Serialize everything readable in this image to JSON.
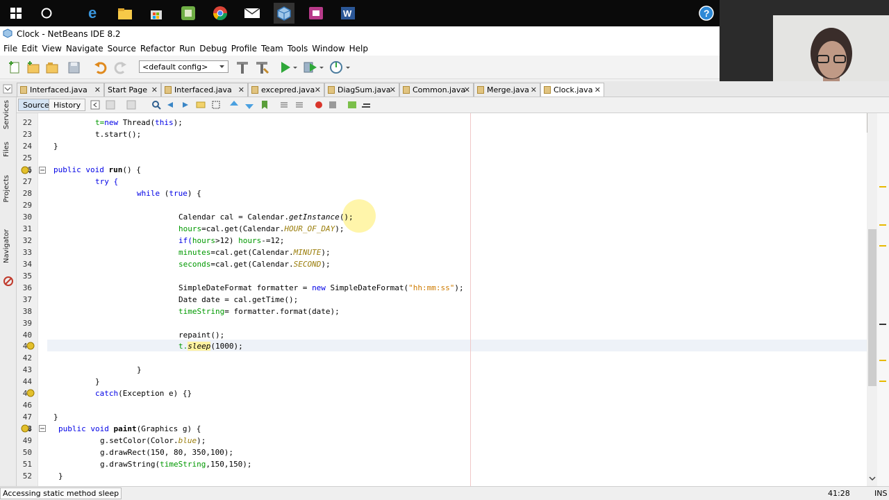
{
  "window": {
    "title": "Clock - NetBeans IDE 8.2"
  },
  "menu": [
    "File",
    "Edit",
    "View",
    "Navigate",
    "Source",
    "Refactor",
    "Run",
    "Debug",
    "Profile",
    "Team",
    "Tools",
    "Window",
    "Help"
  ],
  "toolbar": {
    "config_value": "<default config>"
  },
  "tabs": [
    {
      "label": "Interfaced.java"
    },
    {
      "label": "Start Page"
    },
    {
      "label": "Interfaced.java"
    },
    {
      "label": "excepred.java"
    },
    {
      "label": "DiagSum.java"
    },
    {
      "label": "Common.java"
    },
    {
      "label": "Merge.java"
    },
    {
      "label": "Clock.java",
      "active": true
    }
  ],
  "editor_toolbar": {
    "source_label": "Source",
    "history_label": "History"
  },
  "left_dock": [
    "Services",
    "Files",
    "Projects",
    "Navigator"
  ],
  "lines": [
    "22",
    "23",
    "24",
    "25",
    "26",
    "27",
    "28",
    "29",
    "30",
    "31",
    "32",
    "33",
    "34",
    "35",
    "36",
    "37",
    "38",
    "39",
    "40",
    "41",
    "42",
    "43",
    "44",
    "45",
    "46",
    "47",
    "48",
    "49",
    "50",
    "51",
    "52"
  ],
  "code": {
    "l22a": "t=",
    "l22b": "new",
    "l22c": " Thread(",
    "l22d": "this",
    "l22e": ");",
    "l23": "t.start();",
    "l24": "}",
    "l26a": "public void",
    "l26b": " run",
    "l26c": "() {",
    "l27": "try {",
    "l28a": "while",
    "l28b": " (",
    "l28c": "true",
    "l28d": ") {",
    "l30a": "Calendar cal = Calendar.",
    "l30b": "getInstance",
    "l30c": "();",
    "l31a": "hours",
    "l31b": "=cal.get(Calendar.",
    "l31c": "HOUR_OF_DAY",
    "l31d": ");",
    "l32a": "if(",
    "l32b": "hours",
    "l32c": ">12) ",
    "l32d": "hours",
    "l32e": "-=12;",
    "l33a": "minutes",
    "l33b": "=cal.get(Calendar.",
    "l33c": "MINUTE",
    "l33d": ");",
    "l34a": "seconds",
    "l34b": "=cal.get(Calendar.",
    "l34c": "SECOND",
    "l34d": ");",
    "l36a": "SimpleDateFormat formatter = ",
    "l36b": "new",
    "l36c": " SimpleDateFormat(",
    "l36d": "\"hh:mm:ss\"",
    "l36e": ");",
    "l37": "Date date = cal.getTime();",
    "l38a": "timeString",
    "l38b": "= formatter.format(date);",
    "l40": "repaint();",
    "l41a": "t.",
    "l41b": "sleep",
    "l41c": "(1000);",
    "l43": "}",
    "l44": "}",
    "l45a": "catch",
    "l45b": "(Exception e) {}",
    "l47": "}",
    "l48a": "public void",
    "l48b": " paint",
    "l48c": "(Graphics g) {",
    "l49a": "g.setColor(Color.",
    "l49b": "blue",
    "l49c": ");",
    "l50": "g.drawRect(150, 80, 350,100);",
    "l51a": "g.drawString(",
    "l51b": "timeString",
    "l51c": ",150,150);",
    "l52": "}"
  },
  "status": {
    "message": "Accessing static method sleep",
    "position": "41:28",
    "mode": "INS"
  }
}
